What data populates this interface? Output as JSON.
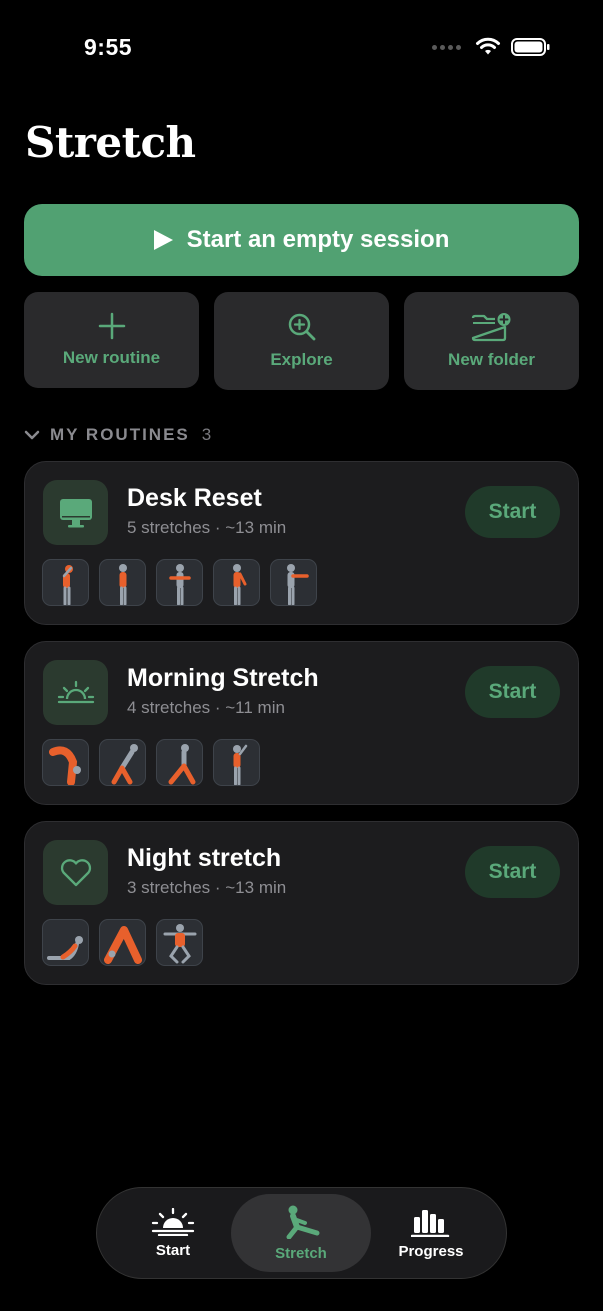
{
  "status": {
    "time": "9:55"
  },
  "page": {
    "title": "Stretch"
  },
  "actions": {
    "start_empty": "Start an empty session",
    "new_routine": "New routine",
    "explore": "Explore",
    "new_folder": "New folder"
  },
  "section": {
    "title": "MY ROUTINES",
    "count": "3"
  },
  "routines": [
    {
      "name": "Desk Reset",
      "meta": "5 stretches · ~13 min",
      "start": "Start",
      "icon": "monitor-icon"
    },
    {
      "name": "Morning Stretch",
      "meta": "4 stretches · ~11 min",
      "start": "Start",
      "icon": "sunrise-icon"
    },
    {
      "name": "Night stretch",
      "meta": "3 stretches · ~13 min",
      "start": "Start",
      "icon": "heart-icon"
    }
  ],
  "tabs": [
    {
      "label": "Start",
      "icon": "sunrise-icon"
    },
    {
      "label": "Stretch",
      "icon": "stretch-figure-icon",
      "selected": true
    },
    {
      "label": "Progress",
      "icon": "bar-chart-icon"
    }
  ],
  "colors": {
    "accent": "#51a172",
    "accent_text": "#5aa97a",
    "card": "#1c1c1e",
    "button_bg": "#2a2a2c",
    "highlight": "#e8602c"
  }
}
